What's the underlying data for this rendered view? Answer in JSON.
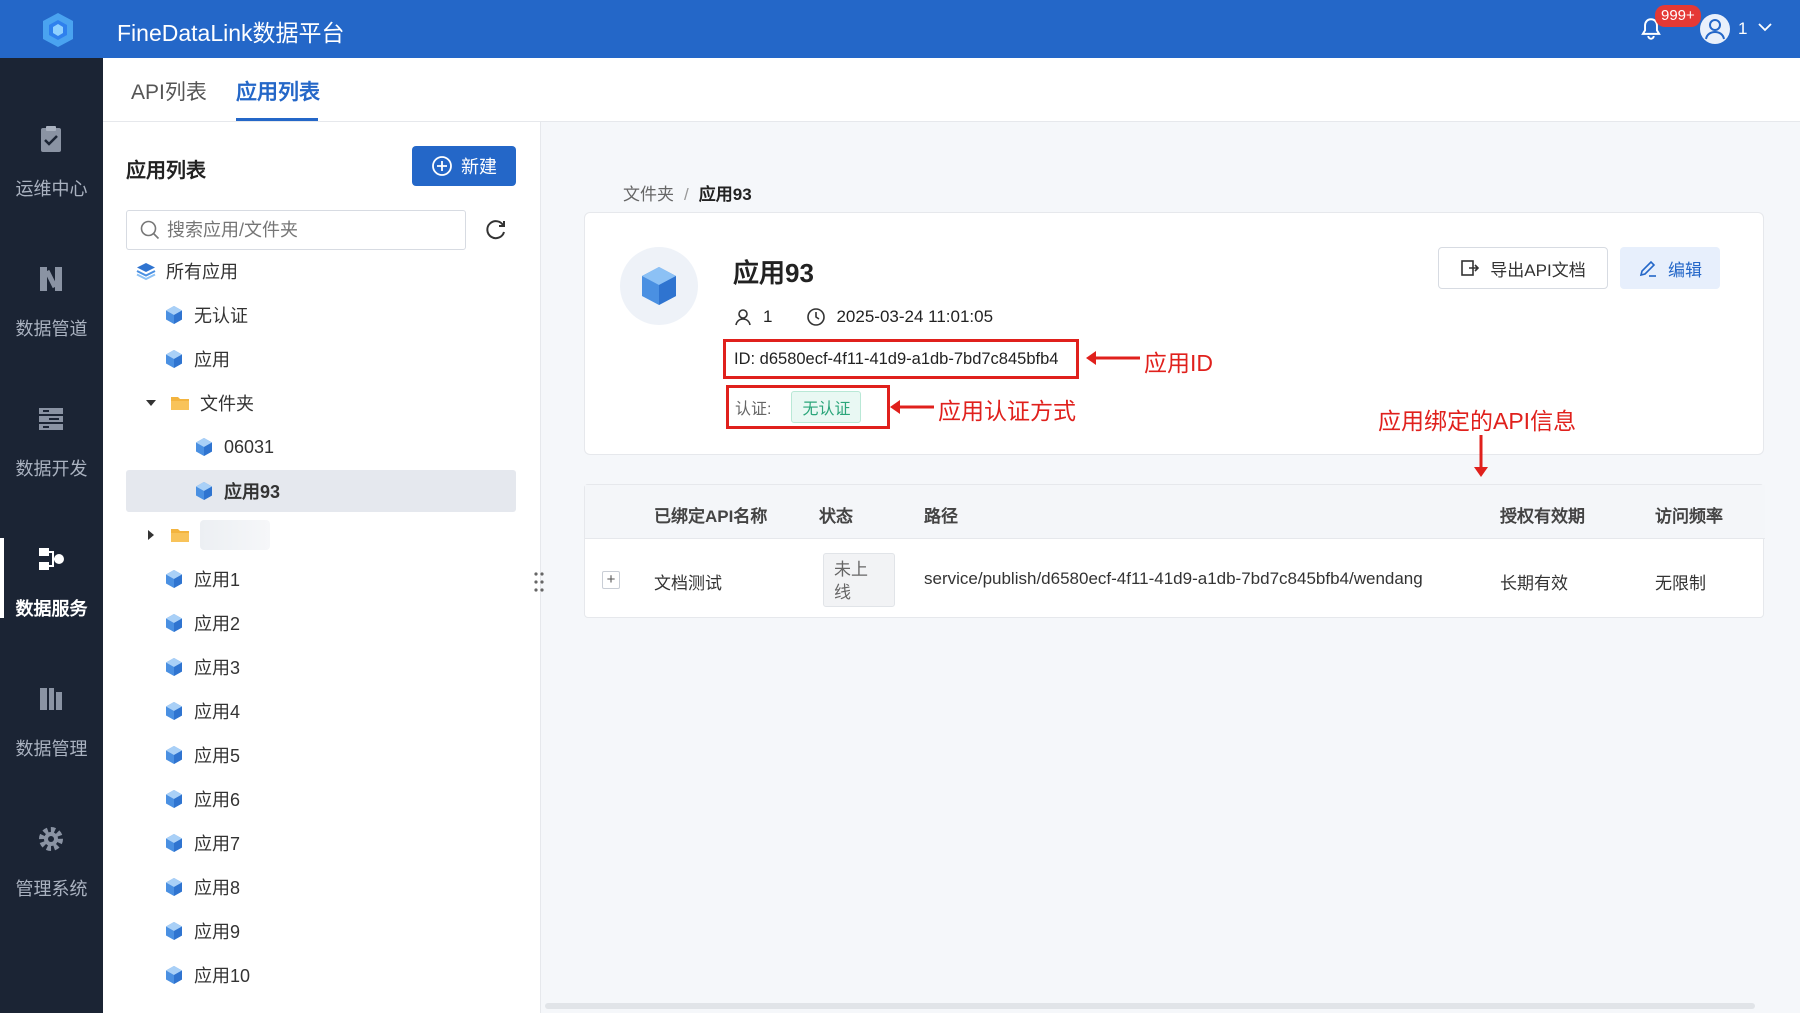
{
  "header": {
    "title": "FineDataLink数据平台",
    "notification_badge": "999+",
    "user_name": "1",
    "brand_color": "#2467c8"
  },
  "nav": {
    "items": [
      {
        "label": "运维中心",
        "icon": "clipboard-check-icon"
      },
      {
        "label": "数据管道",
        "icon": "pipeline-icon"
      },
      {
        "label": "数据开发",
        "icon": "server-stack-icon"
      },
      {
        "label": "数据服务",
        "icon": "data-service-icon",
        "active": true
      },
      {
        "label": "数据管理",
        "icon": "book-shelf-icon"
      },
      {
        "label": "管理系统",
        "icon": "gear-icon"
      }
    ]
  },
  "tabs": [
    {
      "label": "API列表",
      "active": false
    },
    {
      "label": "应用列表",
      "active": true
    }
  ],
  "sidebar": {
    "title": "应用列表",
    "new_button": "新建",
    "search_placeholder": "搜索应用/文件夹",
    "tree": [
      {
        "label": "所有应用",
        "type": "root"
      },
      {
        "label": "无认证",
        "type": "app"
      },
      {
        "label": "应用",
        "type": "app"
      },
      {
        "label": "文件夹",
        "type": "folder",
        "expanded": true
      },
      {
        "label": "06031",
        "type": "app",
        "indent": 2
      },
      {
        "label": "应用93",
        "type": "app",
        "indent": 2,
        "selected": true
      },
      {
        "label": "",
        "type": "folder",
        "expanded": false,
        "blurred": true
      },
      {
        "label": "应用1",
        "type": "app"
      },
      {
        "label": "应用2",
        "type": "app"
      },
      {
        "label": "应用3",
        "type": "app"
      },
      {
        "label": "应用4",
        "type": "app"
      },
      {
        "label": "应用5",
        "type": "app"
      },
      {
        "label": "应用6",
        "type": "app"
      },
      {
        "label": "应用7",
        "type": "app"
      },
      {
        "label": "应用8",
        "type": "app"
      },
      {
        "label": "应用9",
        "type": "app"
      },
      {
        "label": "应用10",
        "type": "app"
      }
    ]
  },
  "breadcrumb": {
    "parent": "文件夹",
    "separator": "/",
    "current": "应用93"
  },
  "app_detail": {
    "name": "应用93",
    "owner": "1",
    "created": "2025-03-24 11:01:05",
    "id_label": "ID: d6580ecf-4f11-41d9-a1db-7bd7c845bfb4",
    "auth_label": "认证:",
    "auth_value": "无认证",
    "export_button": "导出API文档",
    "edit_button": "编辑"
  },
  "annotations": {
    "app_id": "应用ID",
    "auth_method": "应用认证方式",
    "bound_api": "应用绑定的API信息",
    "color": "#e0201c"
  },
  "api_table": {
    "headers": [
      "已绑定API名称",
      "状态",
      "路径",
      "授权有效期",
      "访问频率"
    ],
    "rows": [
      {
        "name": "文档测试",
        "status": "未上线",
        "path": "service/publish/d6580ecf-4f11-41d9-a1db-7bd7c845bfb4/wendang",
        "validity": "长期有效",
        "frequency": "无限制"
      }
    ]
  }
}
